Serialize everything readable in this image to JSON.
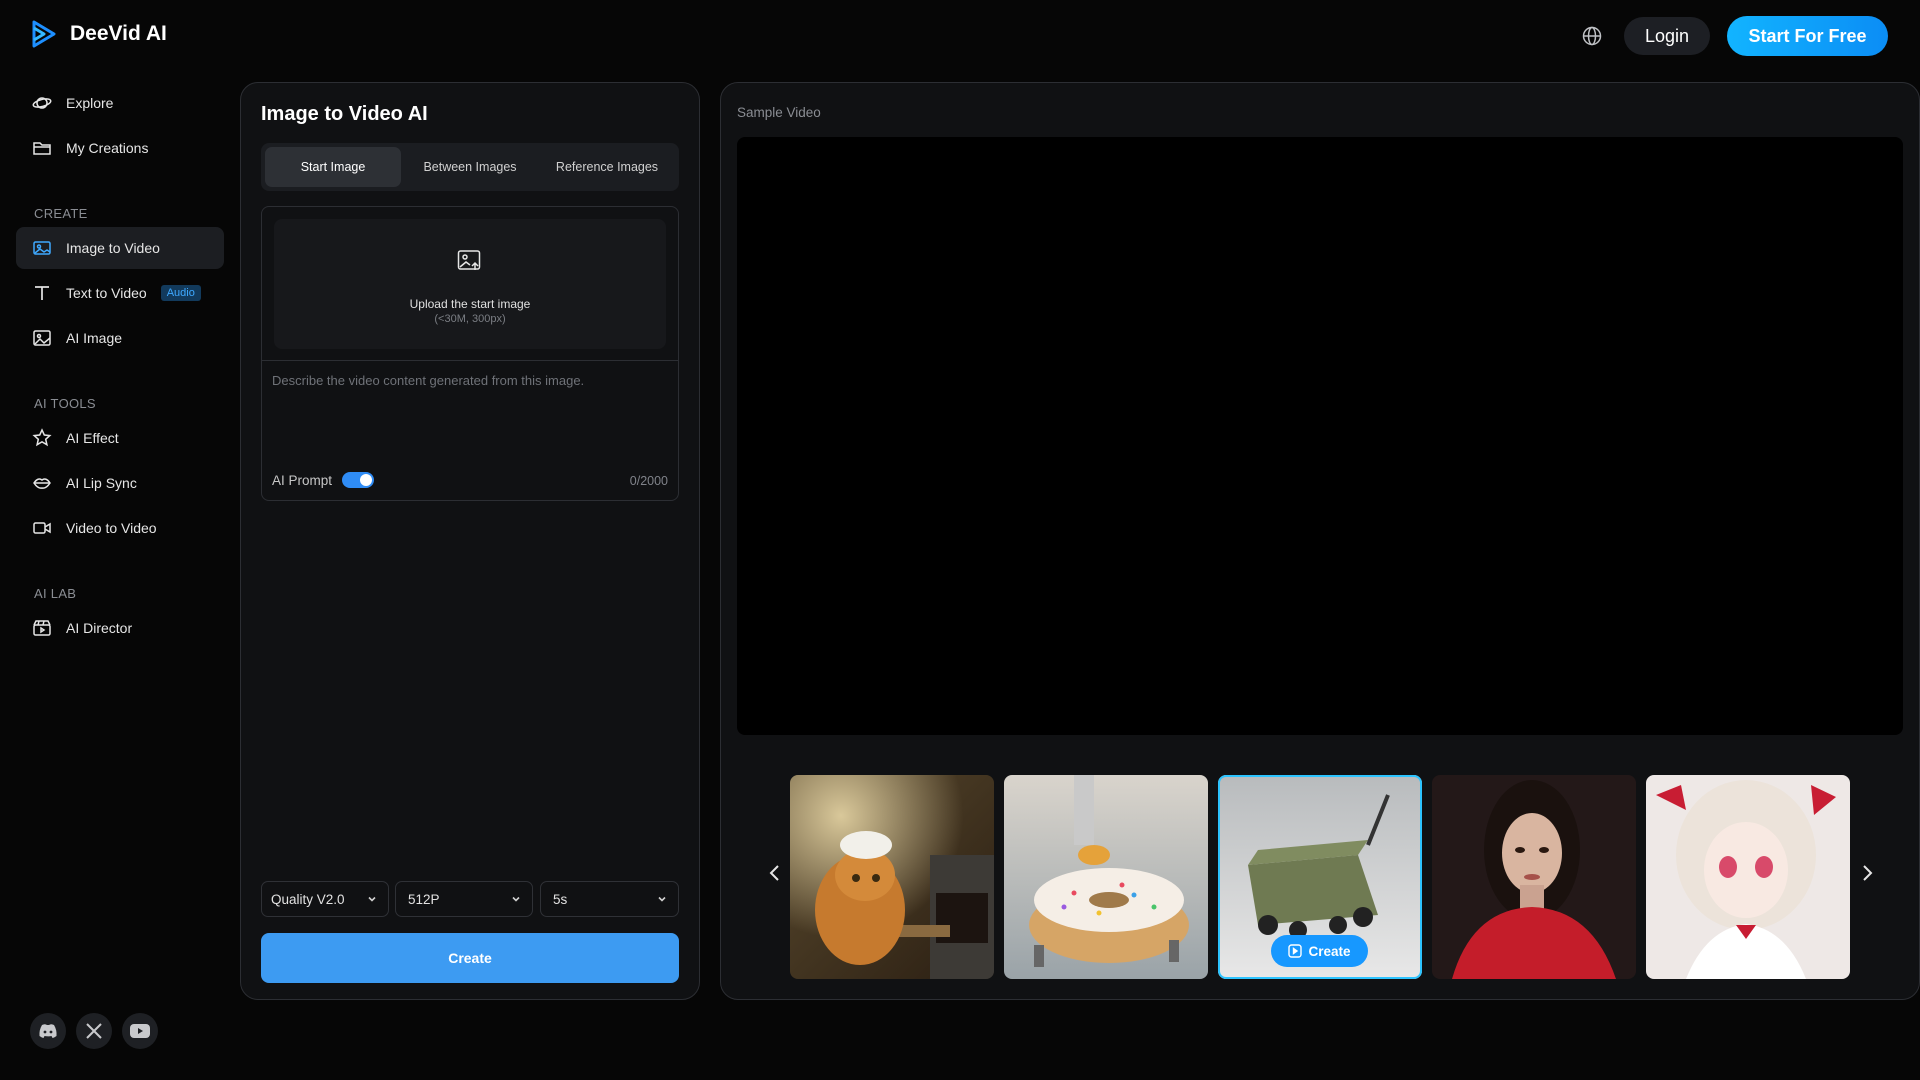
{
  "brand": {
    "name": "DeeVid AI",
    "accent": "#1da1ff"
  },
  "header": {
    "login_label": "Login",
    "start_label": "Start For Free"
  },
  "sidebar": {
    "top_items": [
      {
        "label": "Explore",
        "icon": "planet-icon"
      },
      {
        "label": "My Creations",
        "icon": "folder-icon"
      }
    ],
    "create_label": "CREATE",
    "create_items": [
      {
        "label": "Image to Video",
        "icon": "image-icon",
        "active": true
      },
      {
        "label": "Text to Video",
        "icon": "text-icon",
        "badge": "Audio"
      },
      {
        "label": "AI Image",
        "icon": "ai-image-icon"
      }
    ],
    "tools_label": "AI TOOLS",
    "tools_items": [
      {
        "label": "AI Effect",
        "icon": "sparkle-star-icon"
      },
      {
        "label": "AI Lip Sync",
        "icon": "lips-icon"
      },
      {
        "label": "Video to Video",
        "icon": "video-camera-icon"
      }
    ],
    "lab_label": "AI LAB",
    "lab_items": [
      {
        "label": "AI Director",
        "icon": "clapperboard-icon"
      }
    ],
    "social": [
      "discord-icon",
      "x-icon",
      "youtube-icon"
    ]
  },
  "left_panel": {
    "title": "Image to Video AI",
    "tabs": [
      "Start Image",
      "Between Images",
      "Reference Images"
    ],
    "active_tab": "Start Image",
    "upload_text": "Upload the start image",
    "upload_sub": "(<30M, 300px)",
    "prompt_placeholder": "Describe the video content generated from this image.",
    "ai_prompt_label": "AI Prompt",
    "ai_prompt_on": true,
    "counter": "0/2000",
    "quality": "Quality V2.0",
    "resolution": "512P",
    "duration": "5s",
    "create_label": "Create"
  },
  "right_panel": {
    "label": "Sample Video",
    "thumbnails": [
      {
        "subject": "cat chef baking cookies"
      },
      {
        "subject": "donut with tiny workers"
      },
      {
        "subject": "folding wagon",
        "selected": true,
        "button": "Create"
      },
      {
        "subject": "woman in red sweater"
      },
      {
        "subject": "anime girl"
      }
    ]
  }
}
